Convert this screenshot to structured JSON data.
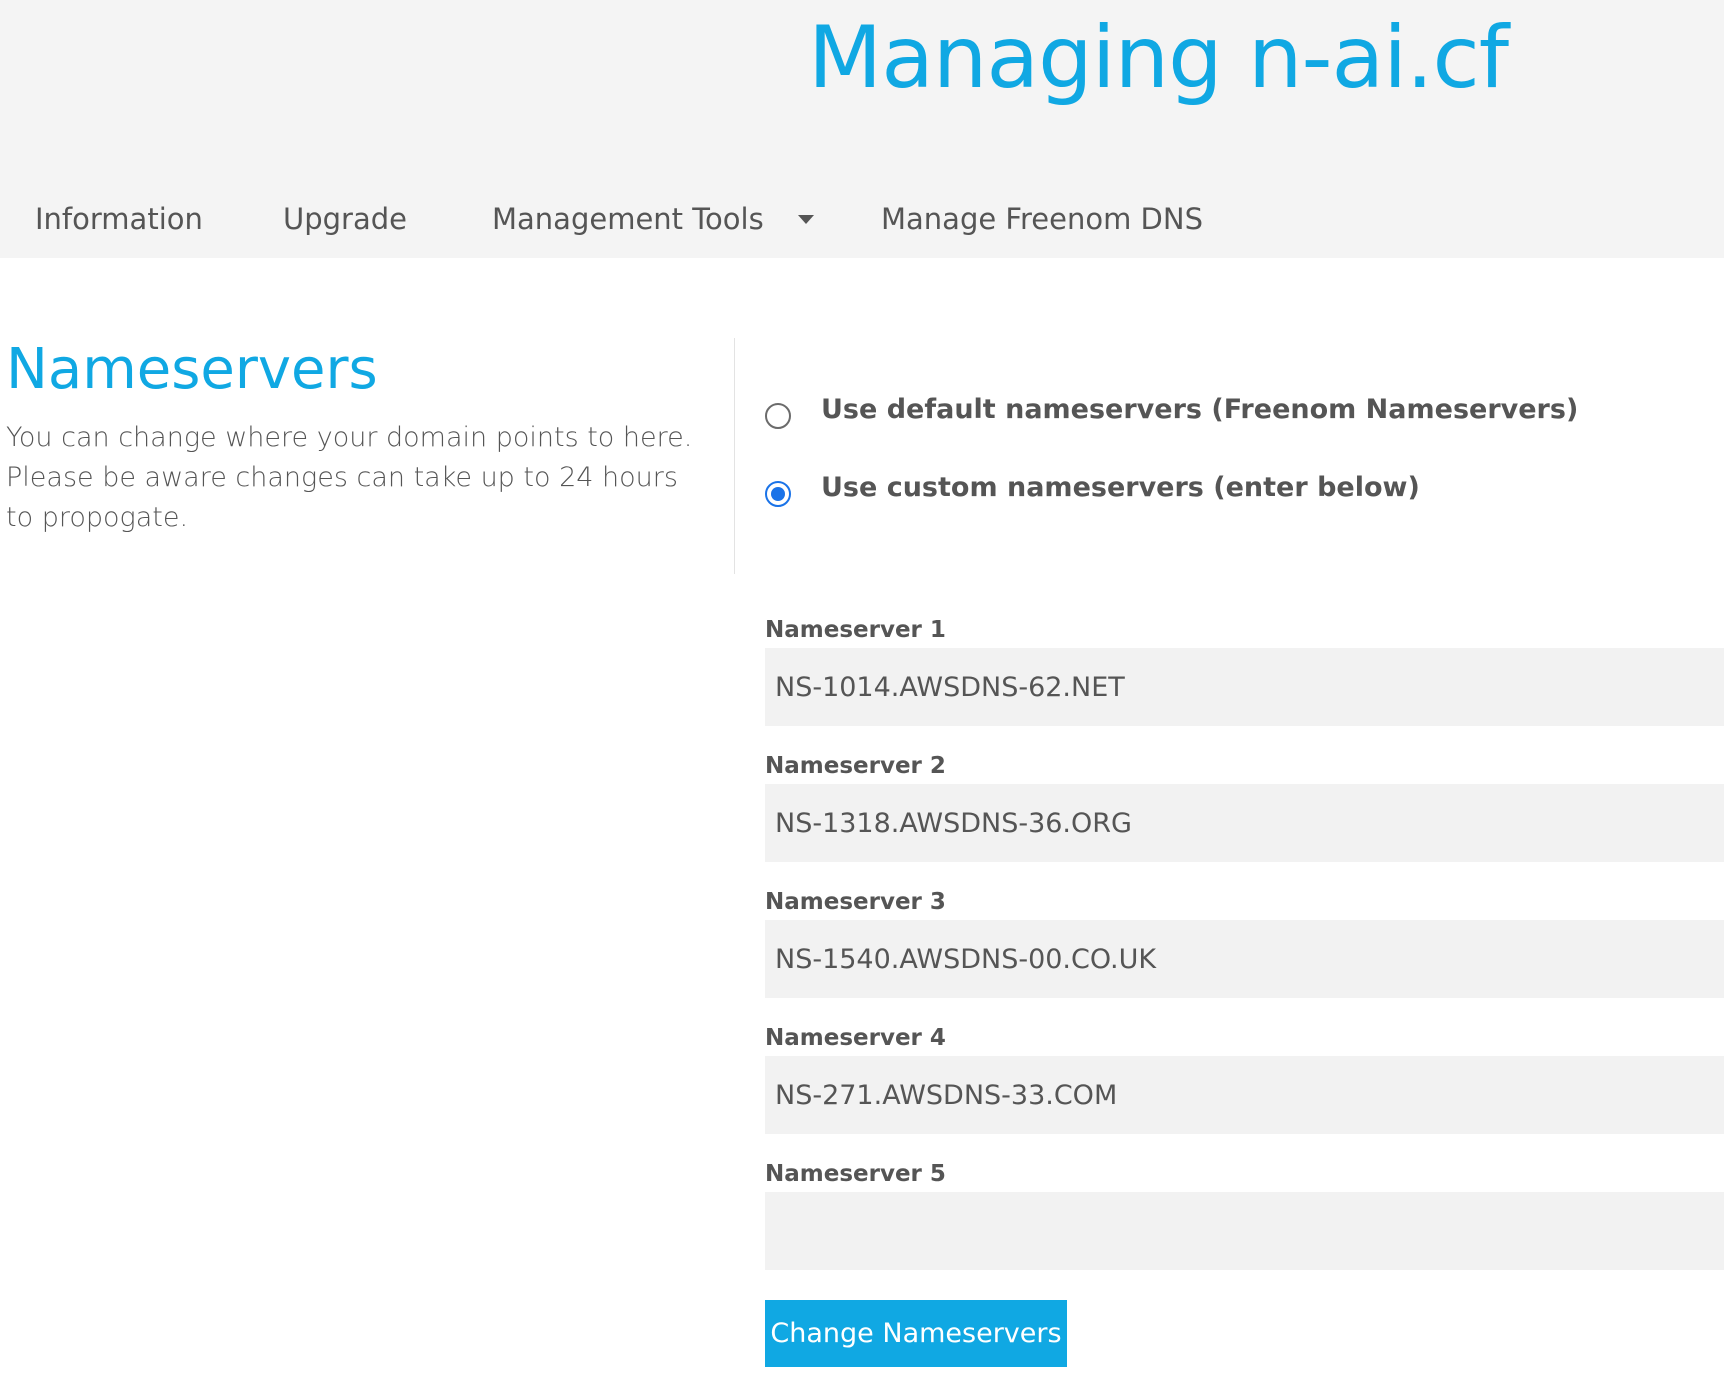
{
  "header": {
    "title": "Managing n-ai.cf"
  },
  "nav": {
    "items": [
      {
        "label": "Information"
      },
      {
        "label": "Upgrade"
      },
      {
        "label": "Management Tools",
        "has_dropdown": true
      },
      {
        "label": "Manage Freenom DNS"
      }
    ]
  },
  "section": {
    "title": "Nameservers",
    "description": "You can change where your domain points to here. Please be aware changes can take up to 24 hours to propogate."
  },
  "options": {
    "default_label": "Use default nameservers (Freenom Nameservers)",
    "custom_label": "Use custom nameservers (enter below)",
    "selected": "custom"
  },
  "nameservers": [
    {
      "label": "Nameserver 1",
      "value": "NS-1014.AWSDNS-62.NET"
    },
    {
      "label": "Nameserver 2",
      "value": "NS-1318.AWSDNS-36.ORG"
    },
    {
      "label": "Nameserver 3",
      "value": "NS-1540.AWSDNS-00.CO.UK"
    },
    {
      "label": "Nameserver 4",
      "value": "NS-271.AWSDNS-33.COM"
    },
    {
      "label": "Nameserver 5",
      "value": ""
    }
  ],
  "submit_label": "Change Nameservers",
  "colors": {
    "accent": "#10a8e3",
    "radio_selected": "#1a73e8",
    "header_bg": "#f4f4f4",
    "input_bg": "#f2f2f2",
    "text": "#555555"
  }
}
